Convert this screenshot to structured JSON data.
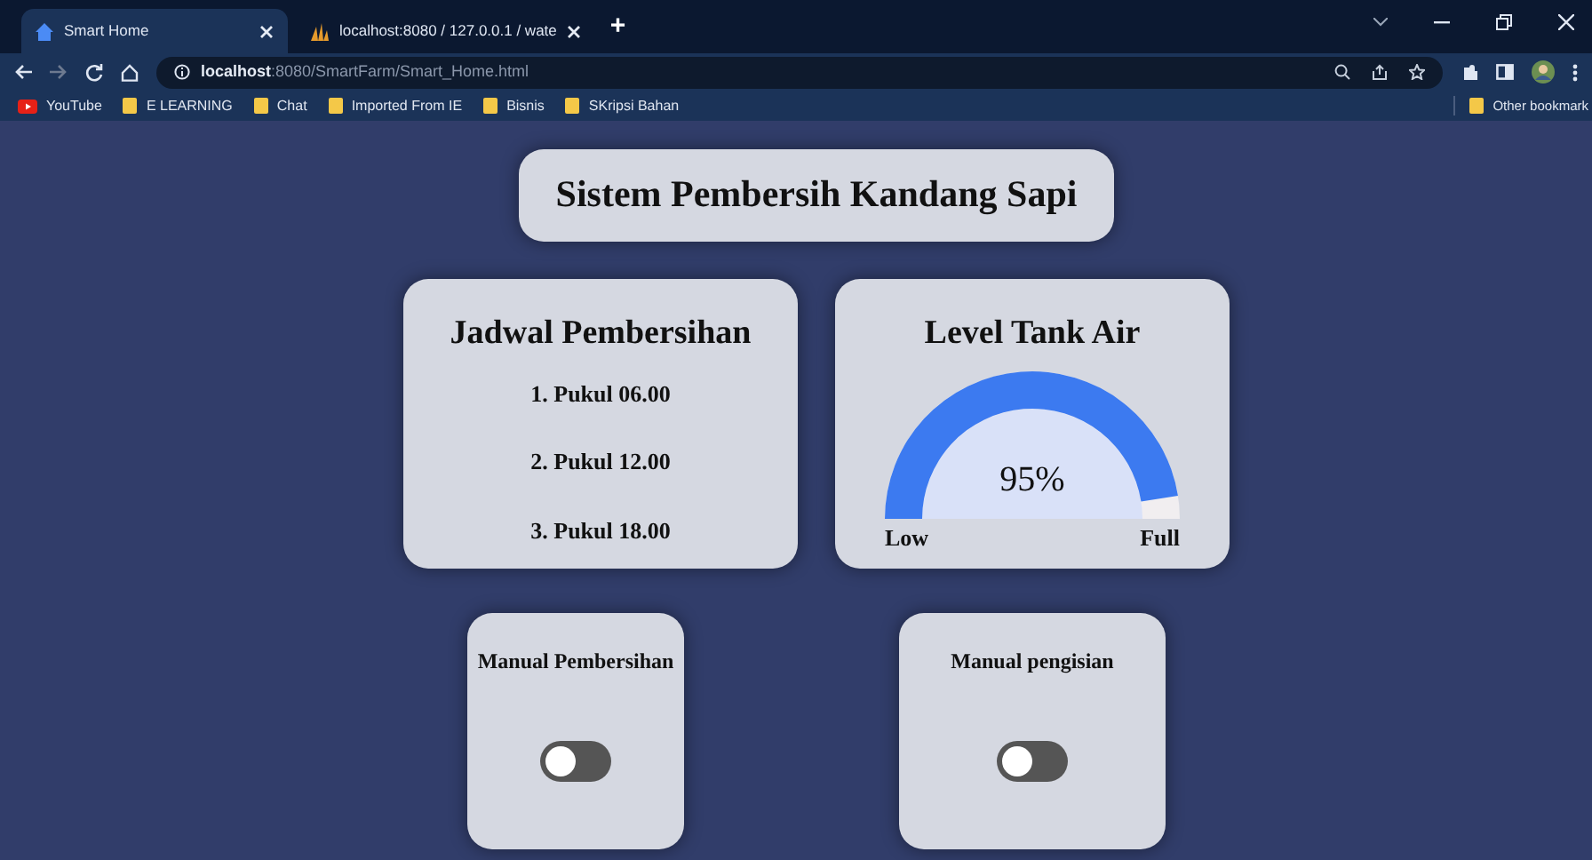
{
  "browser": {
    "tabs": [
      {
        "title": "Smart Home",
        "selected": true
      },
      {
        "title": "localhost:8080 / 127.0.0.1 / wate",
        "selected": false
      }
    ],
    "new_tab": "+",
    "url": {
      "host": "localhost",
      "path": ":8080/SmartFarm/Smart_Home.html"
    },
    "bookmarks": [
      {
        "label": "YouTube",
        "kind": "site"
      },
      {
        "label": "E LEARNING",
        "kind": "folder"
      },
      {
        "label": "Chat",
        "kind": "folder"
      },
      {
        "label": "Imported From IE",
        "kind": "folder"
      },
      {
        "label": "Bisnis",
        "kind": "folder"
      },
      {
        "label": "SKripsi Bahan",
        "kind": "folder"
      }
    ],
    "other_bookmarks": "Other bookmark"
  },
  "page": {
    "title": "Sistem Pembersih Kandang Sapi",
    "schedule": {
      "title": "Jadwal Pembersihan",
      "items": [
        "1. Pukul 06.00",
        "2. Pukul 12.00",
        "3. Pukul 18.00"
      ]
    },
    "tank": {
      "title": "Level Tank Air",
      "level": 0.95,
      "reading": "95%",
      "low_label": "Low",
      "full_label": "Full"
    },
    "switches": [
      {
        "label": "Manual Pembersihan",
        "on": false
      },
      {
        "label": "Manual pengisian",
        "on": false
      }
    ]
  }
}
